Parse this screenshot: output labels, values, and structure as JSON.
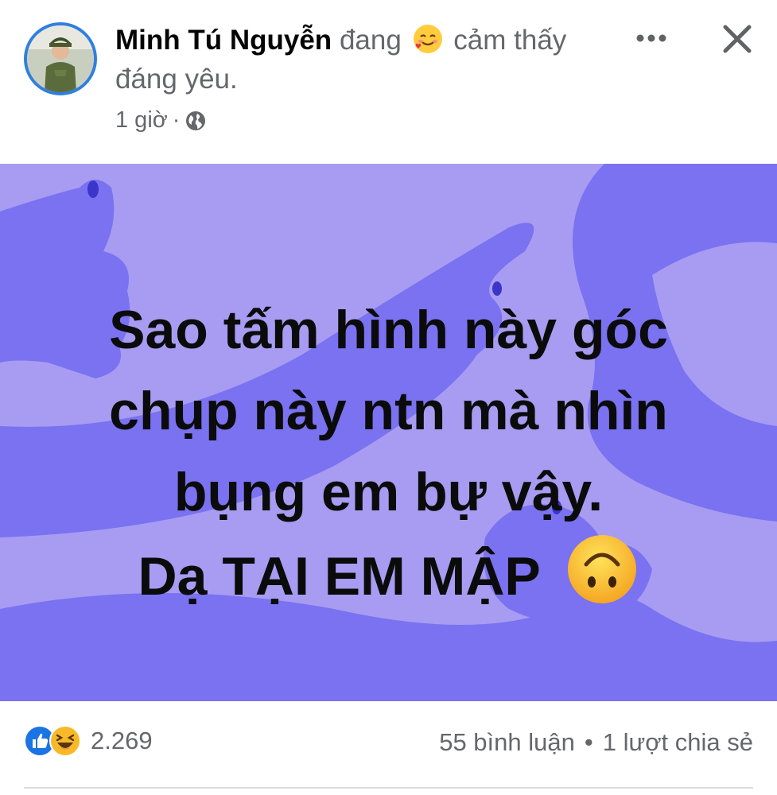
{
  "post": {
    "author": "Minh Tú Nguyễn",
    "feeling_prefix": "đang",
    "feeling_emoji": "smiling-face-with-hearts-icon",
    "feeling_text": "cảm thấy đáng yêu.",
    "time": "1 giờ",
    "dot": "·",
    "privacy_icon": "globe-icon"
  },
  "header": {
    "more_icon": "more-options-icon",
    "close_icon": "close-icon"
  },
  "image": {
    "lines": [
      "Sao tấm hình này góc",
      "chụp này ntn mà nhìn",
      "bụng em bự vậy.",
      "Dạ TẠI EM MẬP"
    ],
    "end_emoji": "upside-down-face-icon",
    "colors": {
      "background": "#a79cf2",
      "shapes": "#7a72f0"
    }
  },
  "footer": {
    "reaction_icons": [
      "like-icon",
      "haha-icon"
    ],
    "reaction_count": "2.269",
    "comments": "55 bình luận",
    "separator": "•",
    "shares": "1 lượt chia sẻ"
  }
}
